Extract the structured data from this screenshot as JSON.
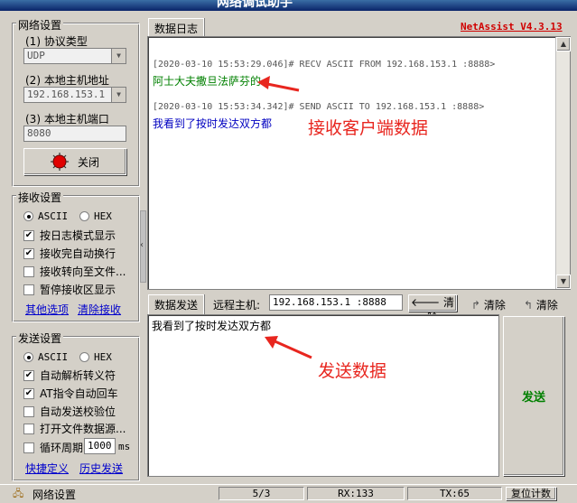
{
  "window": {
    "title": "网络调试助手",
    "brand": "NetAssist V4.3.13",
    "brand_color": "#d00000"
  },
  "net": {
    "group": "网络设置",
    "protocol_label": "(1) 协议类型",
    "protocol_value": "UDP",
    "host_label": "(2) 本地主机地址",
    "host_value": "192.168.153.1",
    "port_label": "(3) 本地主机端口",
    "port_value": "8080",
    "close_button": "关闭"
  },
  "recv": {
    "group": "接收设置",
    "ascii": "ASCII",
    "hex": "HEX",
    "options": [
      {
        "label": "按日志模式显示",
        "checked": true
      },
      {
        "label": "接收完自动换行",
        "checked": true
      },
      {
        "label": "接收转向至文件...",
        "checked": false
      },
      {
        "label": "暂停接收区显示",
        "checked": false
      }
    ],
    "link_more": "其他选项",
    "link_clear": "清除接收"
  },
  "send": {
    "group": "发送设置",
    "ascii": "ASCII",
    "hex": "HEX",
    "options": [
      {
        "label": "自动解析转义符",
        "checked": true
      },
      {
        "label": "AT指令自动回车",
        "checked": true
      },
      {
        "label": "自动发送校验位",
        "checked": false
      },
      {
        "label": "打开文件数据源...",
        "checked": false
      }
    ],
    "loop_label": "循环周期",
    "loop_value": "1000",
    "loop_unit": "ms",
    "link_quick": "快捷定义",
    "link_history": "历史发送"
  },
  "log": {
    "tab": "数据日志",
    "entries": [
      {
        "header": "[2020-03-10 15:53:29.046]# RECV ASCII FROM 192.168.153.1 :8888>",
        "text": "阿士大夫撒旦法萨芬的",
        "color": "#008000"
      },
      {
        "header": "[2020-03-10 15:53:34.342]# SEND ASCII TO 192.168.153.1 :8888>",
        "text": "我看到了按时发达双方都",
        "color": "#0000c0"
      }
    ],
    "annotation": "接收客户端数据"
  },
  "sendarea": {
    "tab": "数据发送",
    "remote_label": "远程主机:",
    "remote_value": "192.168.153.1 :8888",
    "clear1": "清除",
    "clear2": "清除",
    "clear3": "清除",
    "text": "我看到了按时发达双方都",
    "send_button": "发送",
    "annotation": "发送数据"
  },
  "status": {
    "label": "网络设置",
    "count": "5/3",
    "rx": "RX:133",
    "tx": "TX:65",
    "reset": "复位计数"
  }
}
